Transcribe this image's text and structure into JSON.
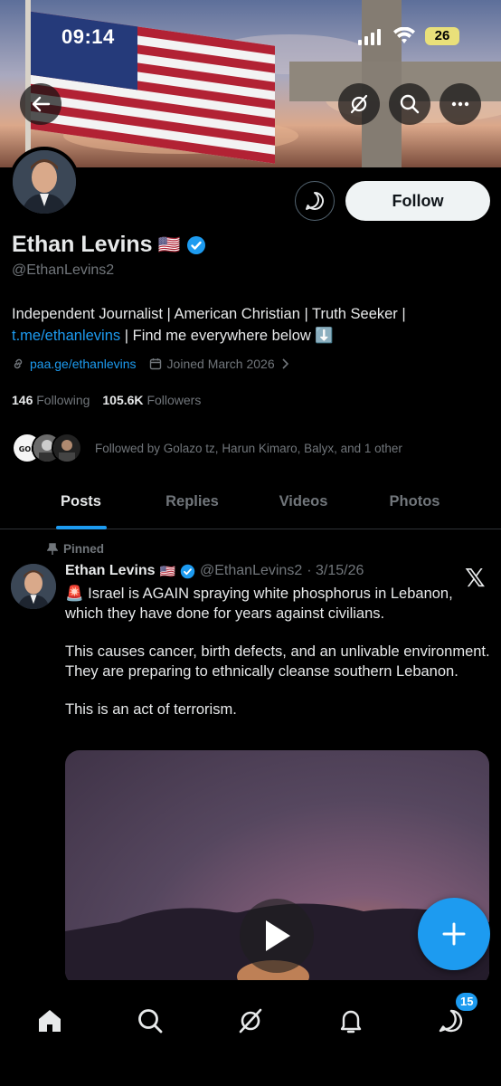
{
  "status_bar": {
    "time": "09:14",
    "battery": "26"
  },
  "profile": {
    "display_name": "Ethan Levins",
    "flag": "🇺🇸",
    "handle": "@EthanLevins2",
    "follow_label": "Follow",
    "bio_text": "Independent Journalist | American Christian | Truth Seeker | ",
    "bio_link": "t.me/ethanlevins",
    "bio_rest": " | Find me everywhere below ⬇️",
    "website": "paa.ge/ethanlevins",
    "joined": "Joined March 2026",
    "following_count": "146",
    "following_label": "Following",
    "followers_count": "105.6K",
    "followers_label": "Followers",
    "followed_by": "Followed by Golazo tz, Harun Kimaro, Balyx, and 1 other"
  },
  "tabs": [
    {
      "label": "Posts",
      "active": true
    },
    {
      "label": "Replies",
      "active": false
    },
    {
      "label": "Videos",
      "active": false
    },
    {
      "label": "Photos",
      "active": false
    }
  ],
  "pinned_post": {
    "pinned_label": "Pinned",
    "author_name": "Ethan Levins",
    "flag": "🇺🇸",
    "author_handle": "@EthanLevins2",
    "date": "· 3/15/26",
    "paragraphs": [
      "🚨 Israel is AGAIN spraying white phosphorus in Lebanon, which they have done for years against civilians.",
      "This causes cancer, birth defects, and an unlivable environment. They are preparing to ethnically cleanse southern Lebanon.",
      "This is an act of terrorism."
    ]
  },
  "nav": {
    "messages_badge": "15"
  },
  "colors": {
    "accent": "#1d9bf0",
    "background": "#000000",
    "muted": "#71767b"
  },
  "icons": [
    "back-arrow-icon",
    "grok-icon",
    "search-icon",
    "more-icon",
    "message-icon",
    "verified-icon",
    "link-icon",
    "calendar-icon",
    "chevron-right-icon",
    "pin-icon",
    "x-logo-icon",
    "play-icon",
    "plus-icon",
    "home-icon",
    "notifications-icon",
    "messages-icon"
  ]
}
